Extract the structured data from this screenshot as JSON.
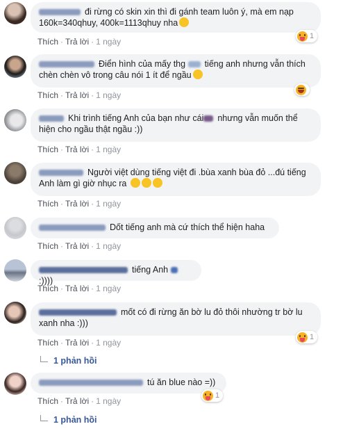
{
  "actions": {
    "like": "Thích",
    "reply": "Trả lời",
    "sep": "·"
  },
  "comments": [
    {
      "text": "đi rừng có skin xin thì đi gánh team luôn ý, mà em nạp 160k=340qhuy, 400k=1113qhuy nha",
      "time": "1 ngày",
      "reaction": "tongue",
      "count": "1"
    },
    {
      "text": "Điển hình của mấy thg",
      "text2": "tiếng anh nhưng vẫn thích chèn chèn vô trong câu nói 1 ít để ngầu",
      "time": "1 ngày",
      "reaction": "laugh",
      "count": ""
    },
    {
      "text": "Khi trình tiếng Anh của bạn như cái",
      "text2": "nhưng vẫn muốn thể hiện cho ngầu thật ngầu :))",
      "time": "1 ngày"
    },
    {
      "text": "Người việt dùng tiếng việt đi .bùa xanh bùa đỏ ...đú tiếng Anh làm gì giờ nhục ra",
      "time": "1 ngày"
    },
    {
      "text": "Dốt tiếng anh mà cứ thích thể hiện haha",
      "time": "1 ngày"
    },
    {
      "text": "tiếng Anh",
      "text2": ":))))",
      "time": "1 ngày"
    },
    {
      "text": "mốt có đi rừng ăn bờ lu đỏ thôi nhường tr bờ lu xanh nha :)))",
      "time": "1 ngày",
      "reaction": "tongue",
      "count": "1"
    },
    {
      "text": "tú ăn blue nào =))",
      "time": "1 ngày",
      "reaction": "tongue",
      "count": "1"
    }
  ],
  "replies": [
    "1 phản hồi",
    "1 phản hồi"
  ]
}
